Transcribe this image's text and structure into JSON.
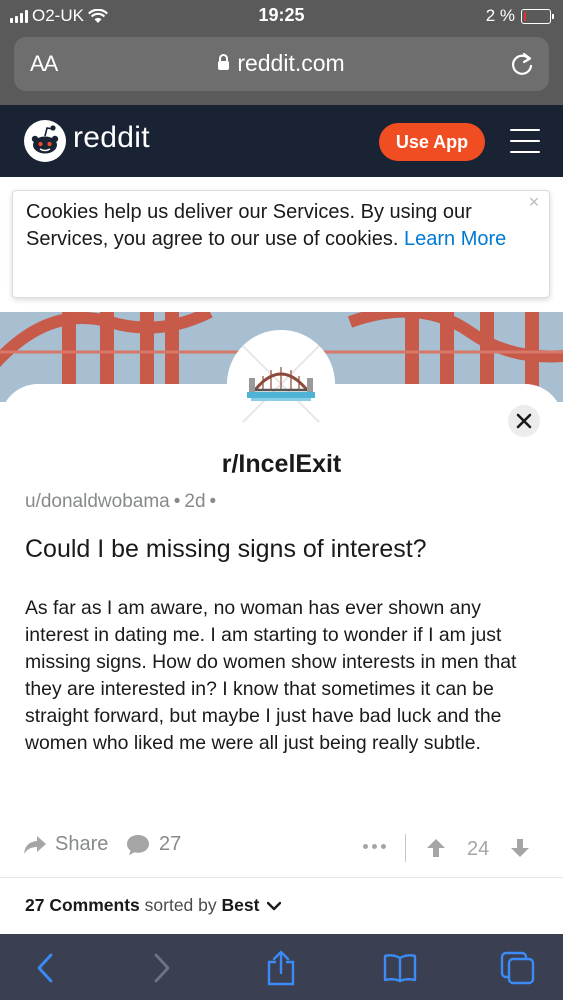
{
  "status_bar": {
    "carrier": "O2-UK",
    "time": "19:25",
    "battery_percent": "2 %"
  },
  "browser": {
    "text_size_label": "AA",
    "url": "reddit.com"
  },
  "header": {
    "brand": "reddit",
    "use_app_label": "Use App"
  },
  "cookie_banner": {
    "text": "Cookies help us deliver our Services. By using our Services, you agree to our use of cookies.",
    "link_text": "Learn More"
  },
  "post": {
    "subreddit": "r/IncelExit",
    "author": "u/donaldwobama",
    "age": "2d",
    "title": "Could I be missing signs of interest?",
    "body": "As far as I am aware, no woman has ever shown any interest in dating me. I am starting to wonder if I am just missing signs. How do women show interests in men that they are interested in? I know that sometimes it can be straight forward, but maybe I just have bad luck and the women who liked me were all just being really subtle.",
    "share_label": "Share",
    "comment_count": "27",
    "vote_count": "24"
  },
  "comments_bar": {
    "count_label": "27 Comments",
    "sorted_by_label": "sorted by",
    "sort_value": "Best"
  },
  "colors": {
    "header_bg": "#1a2333",
    "use_app_bg": "#f04d22",
    "link": "#0079d3",
    "safari_toolbar": "#3a3f52",
    "toolbar_icon": "#3b8cf7"
  },
  "icons": [
    "signal-icon",
    "wifi-icon",
    "battery-icon",
    "lock-icon",
    "reload-icon",
    "snoo-logo-icon",
    "hamburger-menu-icon",
    "close-icon",
    "share-icon",
    "comment-icon",
    "more-icon",
    "upvote-icon",
    "downvote-icon",
    "chevron-down-icon",
    "back-icon",
    "forward-icon",
    "share-sheet-icon",
    "bookmarks-icon",
    "tabs-icon"
  ]
}
